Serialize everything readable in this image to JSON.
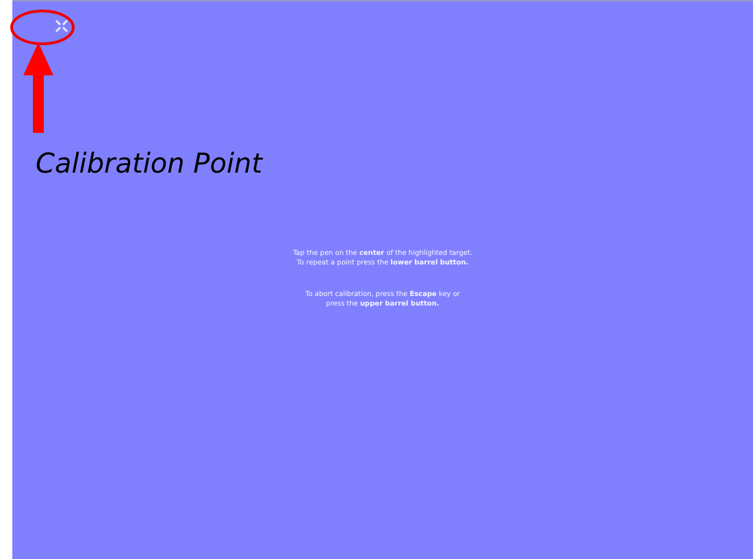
{
  "annotation": {
    "label": "Calibration Point"
  },
  "instructions": [
    "Tap the pen on the **center** of the highlighted target.",
    "To repeat a point press the **lower barrel button.**",
    "To abort calibration, press the **Escape** key or",
    "press the **upper barrel button.**"
  ]
}
